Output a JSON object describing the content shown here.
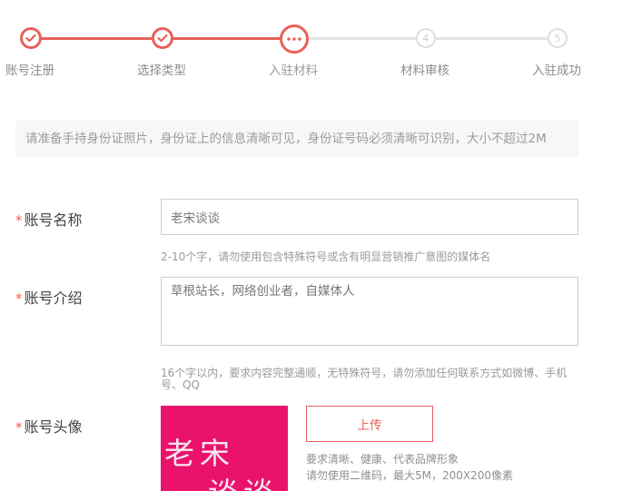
{
  "steps": [
    {
      "label": "账号注册",
      "state": "done",
      "icon": "check-icon"
    },
    {
      "label": "选择类型",
      "state": "done",
      "icon": "check-icon"
    },
    {
      "label": "入驻材料",
      "state": "current",
      "icon": "ellipsis-icon"
    },
    {
      "label": "材料审核",
      "state": "todo",
      "number": "4"
    },
    {
      "label": "入驻成功",
      "state": "todo",
      "number": "5"
    }
  ],
  "notice": "请准备手持身份证照片，身份证上的信息清晰可见，身份证号码必须清晰可识别，大小不超过2M",
  "required_mark": "*",
  "fields": {
    "name": {
      "label": "账号名称",
      "value": "老宋谈谈",
      "hint": "2-10个字，请勿使用包含特殊符号或含有明显营销推广意图的媒体名"
    },
    "intro": {
      "label": "账号介绍",
      "value": "草根站长，网络创业者，自媒体人",
      "hint": "16个字以内，要求内容完整通顺，无特殊符号，请勿添加任何联系方式如微博、手机号、QQ"
    },
    "avatar": {
      "label": "账号头像",
      "image_text_line1": "老宋",
      "image_text_line2": "谈谈",
      "upload_label": "上传",
      "hint_line1": "要求清晰、健康、代表品牌形象",
      "hint_line2": "请勿使用二维码，最大5M，200X200像素"
    }
  },
  "colors": {
    "accent": "#e8605a",
    "inactive": "#dedede",
    "avatar_bg": "#e9136d"
  }
}
